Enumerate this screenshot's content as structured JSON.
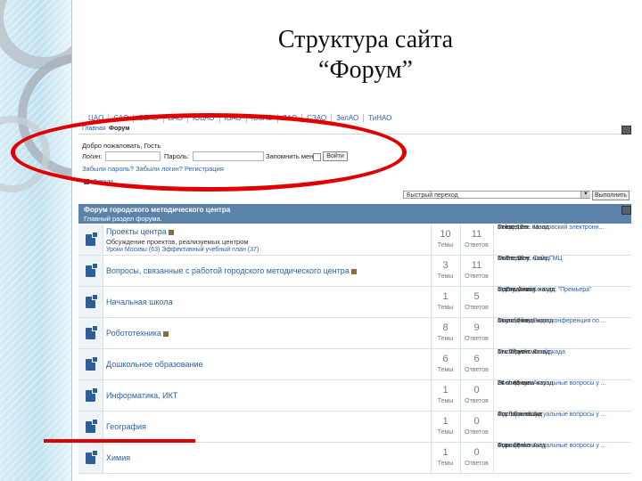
{
  "slide": {
    "title_line1": "Структура  сайта",
    "title_line2": "“Форум”"
  },
  "district_nav": [
    "ЦАО",
    "САО",
    "СВАО",
    "ВАО",
    "ЮВАО",
    "ЮАО",
    "ЮЗАО",
    "ЗАО",
    "СЗАО",
    "ЗелАО",
    "ТиНАО"
  ],
  "breadcrumb": {
    "home": "Главная",
    "current": "Форум"
  },
  "login": {
    "welcome": "Добро пожаловать, Гость",
    "login_label": "Логин:",
    "password_label": "Пароль:",
    "remember_label": "Запомнить меня",
    "submit_label": "Войти",
    "links": "Забыли пароль?   Забыли логин?   Регистрация"
  },
  "forum_link": "Форум",
  "jump": {
    "selected": "Быстрый переход",
    "go_label": "Выполнить"
  },
  "forum_header": {
    "title": "Форум городского методического центра",
    "subtitle": "Главный раздел форума."
  },
  "stat_labels": {
    "topics": "Темы",
    "replies": "Ответов"
  },
  "forums": [
    {
      "name": "Проекты центра",
      "locked": true,
      "desc": "Обсуждение проектов, реализуемых центром",
      "subforums": "Уроки Москвы (63)   Эффективный учебный план (37)",
      "topics": "10",
      "replies": "11",
      "last": [
        "Последнее: Московский электронн...",
        "от katerino",
        "1 нед. 12 ч. назад"
      ]
    },
    {
      "name": "Вопросы, связанные с работой городского методического центра",
      "locked": true,
      "desc": "",
      "subforums": "",
      "topics": "3",
      "replies": "11",
      "last": [
        "Последнее: Сайт ГМЦ",
        "от Trerskoy",
        "1 мес. 19 ч. назад"
      ]
    },
    {
      "name": "Начальная школа",
      "locked": false,
      "desc": "",
      "subforums": "",
      "topics": "1",
      "replies": "5",
      "last": [
        "Последнее: Конкурс \"Премьера\"",
        "от Gryakinaig",
        "1 день 3 мин. назад"
      ]
    },
    {
      "name": "Робототехника",
      "locked": true,
      "desc": "",
      "subforums": "",
      "topics": "8",
      "replies": "9",
      "last": [
        "Последнее: Видеоконференция по ...",
        "от yudinikova",
        "1 мес. 2 нед. назад"
      ]
    },
    {
      "name": "Дошкольное образование",
      "locked": false,
      "desc": "",
      "subforums": "",
      "topics": "6",
      "replies": "6",
      "last": [
        "Последнее: Слайдкада",
        "от zhilnyckovo",
        "1 ч. 27 мин. назад"
      ]
    },
    {
      "name": "Информатика, ИКТ",
      "locked": false,
      "desc": "",
      "subforums": "",
      "topics": "1",
      "replies": "0",
      "last": [
        "Последнее: Актуальные вопросы у ...",
        "от chemoyna",
        "24 ч. 46 мин. назад"
      ]
    },
    {
      "name": "География",
      "locked": false,
      "desc": "",
      "subforums": "",
      "topics": "1",
      "replies": "0",
      "last": [
        "Последнее: Актуальные вопросы у ...",
        "от zhukovskaya",
        "4 д. 10 ч. назад"
      ]
    },
    {
      "name": "Химия",
      "locked": false,
      "desc": "",
      "subforums": "",
      "topics": "1",
      "replies": "0",
      "last": [
        "Последнее: Актуальные вопросы у ...",
        "от pavlenko",
        "4 дн. 16 ч. назад"
      ]
    }
  ],
  "colors": {
    "accent": "#2a5fa8",
    "header": "#5b82a8",
    "annotation": "#e00000"
  }
}
